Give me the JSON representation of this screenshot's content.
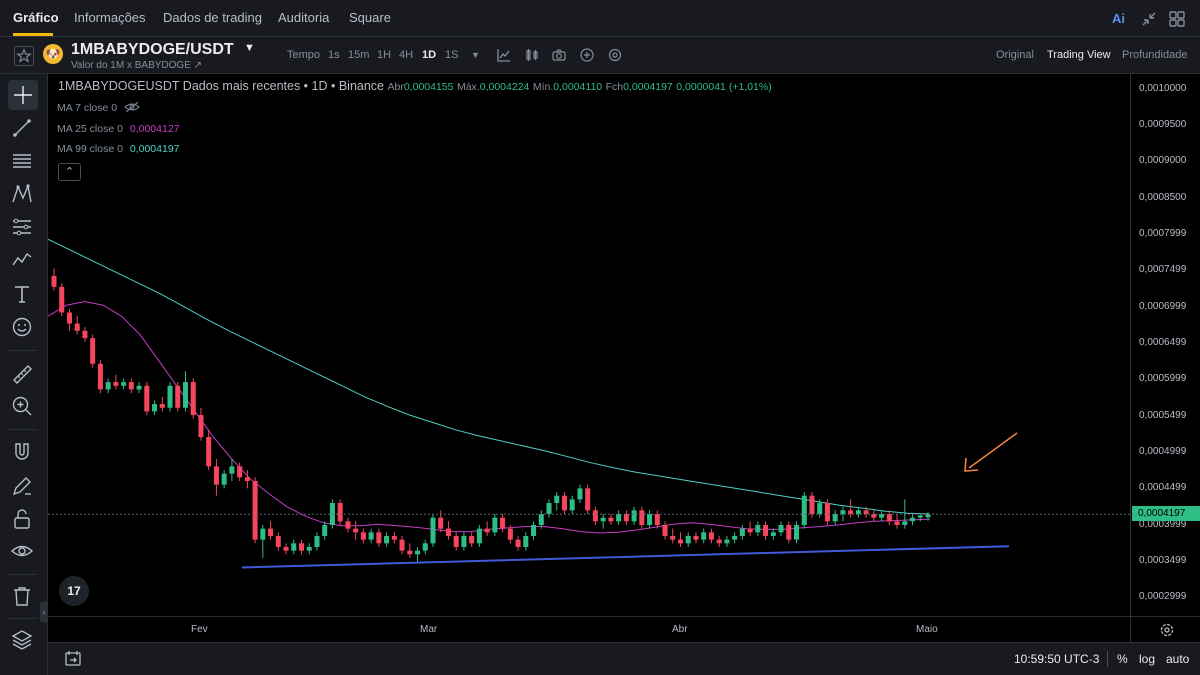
{
  "topnav": {
    "tabs": [
      {
        "label": "Gráfico",
        "active": true
      },
      {
        "label": "Informações"
      },
      {
        "label": "Dados de trading"
      },
      {
        "label": "Auditoria"
      },
      {
        "label": "Square"
      }
    ],
    "icons": [
      "ai-icon",
      "collapse-icon",
      "grid-icon"
    ],
    "ai_label": "Ai"
  },
  "symbol": {
    "name": "1MBABYDOGE/USDT",
    "subtitle": "Valor do 1M x BABYDOGE ↗"
  },
  "timeframes": {
    "items": [
      "Tempo",
      "1s",
      "15m",
      "1H",
      "4H",
      "1D",
      "1S"
    ],
    "active": "1D"
  },
  "views": {
    "items": [
      "Original",
      "Trading View",
      "Profundidade"
    ],
    "active": "Trading View"
  },
  "legend": {
    "title": "1MBABYDOGEUSDT Dados mais recentes • 1D • Binance",
    "open_label": "Abr",
    "open": "0,0004155",
    "high_label": "Máx.",
    "high": "0,0004224",
    "low_label": "Mín.",
    "low": "0,0004110",
    "close_label": "Fch",
    "close": "0,0004197",
    "change": "0,0000041 (+1,01%)"
  },
  "indicators": {
    "ma7": {
      "label": "MA 7 close 0",
      "value": ""
    },
    "ma25": {
      "label": "MA 25 close 0",
      "value": "0,0004127",
      "color": "#c63cc6"
    },
    "ma99": {
      "label": "MA 99 close 0",
      "value": "0,0004197",
      "color": "#4fd1c5"
    },
    "collapse_label": "⌃"
  },
  "price_axis": {
    "labels": [
      "0,0010000",
      "0,0009500",
      "0,0009000",
      "0,0008500",
      "0,0007999",
      "0,0007499",
      "0,0006999",
      "0,0006499",
      "0,0005999",
      "0,0005499",
      "0,0004999",
      "0,0004499",
      "0,0003999",
      "0,0003499",
      "0,0002999"
    ],
    "current": "0,0004197"
  },
  "time_axis": {
    "labels": [
      "Fev",
      "Mar",
      "Abr",
      "Maio"
    ]
  },
  "bottombar": {
    "time": "10:59:50 UTC-3",
    "options": [
      "%",
      "log",
      "auto"
    ]
  },
  "tv_logo": "17",
  "chart_data": {
    "type": "candlestick",
    "up_color": "#2ebd85",
    "down_color": "#f6465d",
    "y_range": [
      0.00028,
      0.00108
    ],
    "candles": [
      [
        0.000745,
        0.000755,
        0.000725,
        0.00073
      ],
      [
        0.00073,
        0.000735,
        0.00069,
        0.000695
      ],
      [
        0.000695,
        0.0007,
        0.00067,
        0.00068
      ],
      [
        0.00068,
        0.00069,
        0.000665,
        0.00067
      ],
      [
        0.00067,
        0.000675,
        0.000655,
        0.00066
      ],
      [
        0.00066,
        0.000665,
        0.00062,
        0.000625
      ],
      [
        0.000625,
        0.00063,
        0.000585,
        0.00059
      ],
      [
        0.00059,
        0.000605,
        0.000585,
        0.0006
      ],
      [
        0.0006,
        0.00061,
        0.00059,
        0.000595
      ],
      [
        0.000595,
        0.000605,
        0.00059,
        0.0006
      ],
      [
        0.0006,
        0.000605,
        0.000585,
        0.00059
      ],
      [
        0.00059,
        0.0006,
        0.000585,
        0.000595
      ],
      [
        0.000595,
        0.0006,
        0.000555,
        0.00056
      ],
      [
        0.00056,
        0.000575,
        0.000555,
        0.00057
      ],
      [
        0.00057,
        0.00058,
        0.00056,
        0.000565
      ],
      [
        0.000565,
        0.0006,
        0.00056,
        0.000595
      ],
      [
        0.000595,
        0.0006,
        0.00056,
        0.000565
      ],
      [
        0.000565,
        0.000615,
        0.00056,
        0.0006
      ],
      [
        0.0006,
        0.000605,
        0.00055,
        0.000555
      ],
      [
        0.000555,
        0.000565,
        0.00052,
        0.000525
      ],
      [
        0.000525,
        0.000535,
        0.00048,
        0.000485
      ],
      [
        0.000485,
        0.000495,
        0.000445,
        0.00046
      ],
      [
        0.00046,
        0.00048,
        0.000455,
        0.000475
      ],
      [
        0.000475,
        0.000495,
        0.000465,
        0.000485
      ],
      [
        0.000485,
        0.00049,
        0.000465,
        0.00047
      ],
      [
        0.00047,
        0.00048,
        0.000455,
        0.000465
      ],
      [
        0.000465,
        0.00047,
        0.00038,
        0.000385
      ],
      [
        0.000385,
        0.000405,
        0.00036,
        0.0004
      ],
      [
        0.0004,
        0.00041,
        0.000385,
        0.00039
      ],
      [
        0.00039,
        0.000395,
        0.00037,
        0.000375
      ],
      [
        0.000375,
        0.00038,
        0.000365,
        0.00037
      ],
      [
        0.00037,
        0.000385,
        0.000365,
        0.00038
      ],
      [
        0.00038,
        0.000385,
        0.000365,
        0.00037
      ],
      [
        0.00037,
        0.00038,
        0.000365,
        0.000375
      ],
      [
        0.000375,
        0.000395,
        0.00037,
        0.00039
      ],
      [
        0.00039,
        0.00041,
        0.000385,
        0.000405
      ],
      [
        0.000405,
        0.00044,
        0.0004,
        0.000435
      ],
      [
        0.000435,
        0.00044,
        0.000405,
        0.00041
      ],
      [
        0.00041,
        0.000415,
        0.000395,
        0.0004
      ],
      [
        0.0004,
        0.00041,
        0.000385,
        0.000395
      ],
      [
        0.000395,
        0.0004,
        0.00038,
        0.000385
      ],
      [
        0.000385,
        0.0004,
        0.00038,
        0.000395
      ],
      [
        0.000395,
        0.0004,
        0.000375,
        0.00038
      ],
      [
        0.00038,
        0.000395,
        0.000375,
        0.00039
      ],
      [
        0.00039,
        0.000395,
        0.00038,
        0.000385
      ],
      [
        0.000385,
        0.00039,
        0.000365,
        0.00037
      ],
      [
        0.00037,
        0.00038,
        0.00036,
        0.000365
      ],
      [
        0.000365,
        0.000375,
        0.000355,
        0.00037
      ],
      [
        0.00037,
        0.000385,
        0.000365,
        0.00038
      ],
      [
        0.00038,
        0.00042,
        0.000375,
        0.000415
      ],
      [
        0.000415,
        0.000425,
        0.000395,
        0.0004
      ],
      [
        0.0004,
        0.00041,
        0.000385,
        0.00039
      ],
      [
        0.00039,
        0.000395,
        0.00037,
        0.000375
      ],
      [
        0.000375,
        0.000395,
        0.00037,
        0.00039
      ],
      [
        0.00039,
        0.000395,
        0.000375,
        0.00038
      ],
      [
        0.00038,
        0.000405,
        0.000375,
        0.0004
      ],
      [
        0.0004,
        0.00041,
        0.00039,
        0.000395
      ],
      [
        0.000395,
        0.00042,
        0.00039,
        0.000415
      ],
      [
        0.000415,
        0.00042,
        0.000395,
        0.0004
      ],
      [
        0.0004,
        0.000405,
        0.00038,
        0.000385
      ],
      [
        0.000385,
        0.00039,
        0.00037,
        0.000375
      ],
      [
        0.000375,
        0.000395,
        0.00037,
        0.00039
      ],
      [
        0.00039,
        0.00041,
        0.000385,
        0.000405
      ],
      [
        0.000405,
        0.000425,
        0.0004,
        0.00042
      ],
      [
        0.00042,
        0.00044,
        0.000415,
        0.000435
      ],
      [
        0.000435,
        0.00045,
        0.000425,
        0.000445
      ],
      [
        0.000445,
        0.00045,
        0.00042,
        0.000425
      ],
      [
        0.000425,
        0.000445,
        0.00042,
        0.00044
      ],
      [
        0.00044,
        0.00046,
        0.000435,
        0.000455
      ],
      [
        0.000455,
        0.00046,
        0.00042,
        0.000425
      ],
      [
        0.000425,
        0.00043,
        0.000405,
        0.00041
      ],
      [
        0.00041,
        0.00042,
        0.0004,
        0.000415
      ],
      [
        0.000415,
        0.00042,
        0.000405,
        0.00041
      ],
      [
        0.00041,
        0.000425,
        0.000405,
        0.00042
      ],
      [
        0.00042,
        0.000425,
        0.000405,
        0.00041
      ],
      [
        0.00041,
        0.00043,
        0.000405,
        0.000425
      ],
      [
        0.000425,
        0.00043,
        0.0004,
        0.000405
      ],
      [
        0.000405,
        0.000425,
        0.0004,
        0.00042
      ],
      [
        0.00042,
        0.000425,
        0.0004,
        0.000405
      ],
      [
        0.000405,
        0.00041,
        0.000385,
        0.00039
      ],
      [
        0.00039,
        0.0004,
        0.00038,
        0.000385
      ],
      [
        0.000385,
        0.000395,
        0.000375,
        0.00038
      ],
      [
        0.00038,
        0.000395,
        0.000375,
        0.00039
      ],
      [
        0.00039,
        0.000395,
        0.00038,
        0.000385
      ],
      [
        0.000385,
        0.0004,
        0.00038,
        0.000395
      ],
      [
        0.000395,
        0.0004,
        0.00038,
        0.000385
      ],
      [
        0.000385,
        0.00039,
        0.000375,
        0.00038
      ],
      [
        0.00038,
        0.00039,
        0.000375,
        0.000385
      ],
      [
        0.000385,
        0.000395,
        0.00038,
        0.00039
      ],
      [
        0.00039,
        0.000405,
        0.000385,
        0.0004
      ],
      [
        0.0004,
        0.00041,
        0.00039,
        0.000395
      ],
      [
        0.000395,
        0.00041,
        0.00039,
        0.000405
      ],
      [
        0.000405,
        0.00041,
        0.000385,
        0.00039
      ],
      [
        0.00039,
        0.0004,
        0.000385,
        0.000395
      ],
      [
        0.000395,
        0.00041,
        0.00039,
        0.000405
      ],
      [
        0.000405,
        0.00041,
        0.00038,
        0.000385
      ],
      [
        0.000385,
        0.00041,
        0.00038,
        0.000405
      ],
      [
        0.000405,
        0.00045,
        0.0004,
        0.000445
      ],
      [
        0.000445,
        0.00045,
        0.000415,
        0.00042
      ],
      [
        0.00042,
        0.00044,
        0.000415,
        0.000435
      ],
      [
        0.000435,
        0.00044,
        0.000405,
        0.00041
      ],
      [
        0.00041,
        0.000425,
        0.000405,
        0.00042
      ],
      [
        0.00042,
        0.00043,
        0.00041,
        0.000425
      ],
      [
        0.000425,
        0.00044,
        0.000415,
        0.00042
      ],
      [
        0.00042,
        0.00043,
        0.000415,
        0.000425
      ],
      [
        0.000425,
        0.00043,
        0.000415,
        0.00042
      ],
      [
        0.00042,
        0.000425,
        0.00041,
        0.000415
      ],
      [
        0.000415,
        0.000425,
        0.00041,
        0.00042
      ],
      [
        0.00042,
        0.000425,
        0.000405,
        0.00041
      ],
      [
        0.00041,
        0.00042,
        0.0004,
        0.000405
      ],
      [
        0.000405,
        0.00044,
        0.0004,
        0.00041
      ],
      [
        0.00041,
        0.00042,
        0.000405,
        0.000415
      ],
      [
        0.000415,
        0.00042,
        0.00041,
        0.000418
      ],
      [
        0.0004155,
        0.0004224,
        0.000411,
        0.0004197
      ]
    ],
    "ma25": [
      0.00069,
      0.000705,
      0.00071,
      0.000705,
      0.00069,
      0.000665,
      0.00063,
      0.000595,
      0.00056,
      0.000525,
      0.000495,
      0.000468,
      0.000448,
      0.00043,
      0.000417,
      0.000408,
      0.000404,
      0.000404,
      0.000406,
      0.000404,
      0.000402,
      0.000399,
      0.000396,
      0.000396,
      0.000399,
      0.000401,
      0.000403,
      0.000403,
      0.0004,
      0.000396,
      0.000394,
      0.000395,
      0.000398,
      0.000402,
      0.000406,
      0.000408,
      0.000406,
      0.000403,
      0.0004,
      0.000399,
      0.000399,
      0.000401,
      0.000403,
      0.000405,
      0.000408,
      0.00041,
      0.000411,
      0.000412,
      0.000413
    ],
    "ma99": [
      0.000795,
      0.00078,
      0.000765,
      0.00075,
      0.000735,
      0.00072,
      0.000703,
      0.000686,
      0.00067,
      0.000655,
      0.00064,
      0.000625,
      0.00061,
      0.000595,
      0.00058,
      0.000567,
      0.000555,
      0.000545,
      0.000535,
      0.000527,
      0.00052,
      0.000513,
      0.000506,
      0.000498,
      0.00049,
      0.000483,
      0.000477,
      0.000472,
      0.000467,
      0.000462,
      0.000457,
      0.000452,
      0.000447,
      0.000442,
      0.000437,
      0.000432,
      0.000428,
      0.000424,
      0.000421,
      0.00042
    ],
    "trendline": {
      "x_from": "2023-02-07",
      "x_to": "2023-05-10",
      "y_from": 0.000347,
      "y_to": 0.000376
    },
    "annotation_arrow_color": "#f0803c",
    "trendline_color": "#3f5bd9"
  }
}
